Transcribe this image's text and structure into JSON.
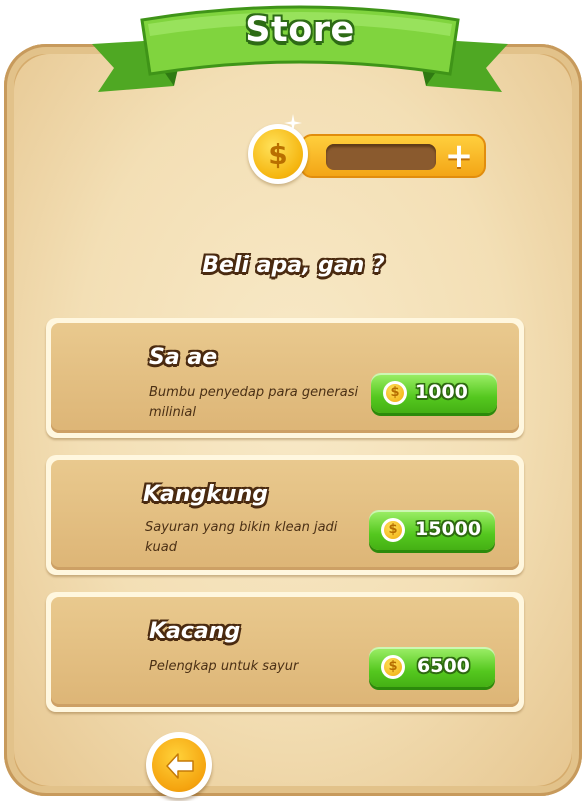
{
  "header": {
    "title": "Store"
  },
  "currency": {
    "symbol": "$",
    "balance": "",
    "add_label": "+"
  },
  "prompt": "Beli apa, gan ?",
  "items": [
    {
      "name": "Sa ae",
      "description": "Bumbu penyedap para generasi milinial",
      "price": "1000",
      "coin_symbol": "$"
    },
    {
      "name": "Kangkung",
      "description": "Sayuran yang bikin klean jadi kuad",
      "price": "15000",
      "coin_symbol": "$"
    },
    {
      "name": "Kacang",
      "description": "Pelengkap untuk sayur",
      "price": "6500",
      "coin_symbol": "$"
    }
  ],
  "colors": {
    "ribbon_green": "#7fd23c",
    "button_green": "#55c81f",
    "coin_gold": "#f5b50f",
    "parchment": "#f3dfb5"
  },
  "icons": {
    "back": "arrow-left-icon",
    "coin": "dollar-coin-icon",
    "sparkle": "sparkle-icon"
  }
}
